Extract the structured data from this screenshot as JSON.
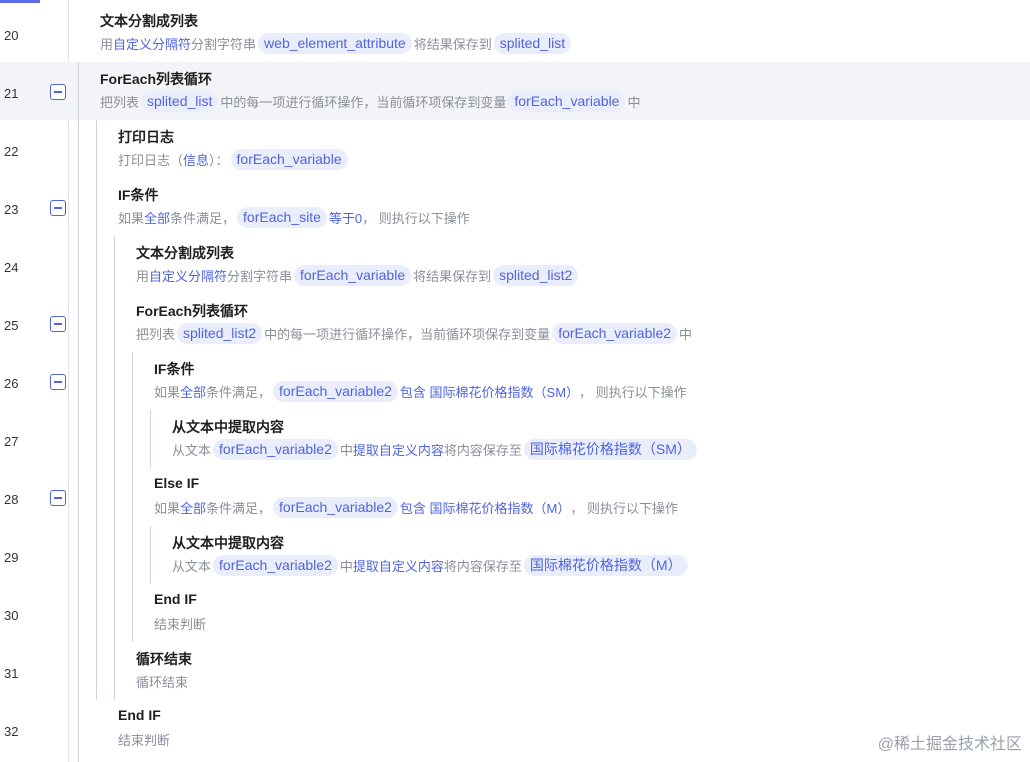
{
  "lines": [
    {
      "num": "20",
      "title": "文本分割成列表",
      "desc": [
        {
          "t": "text",
          "v": "用"
        },
        {
          "t": "kw",
          "v": "自定义分隔符"
        },
        {
          "t": "text",
          "v": "分割字符串"
        },
        {
          "t": "chip",
          "v": "web_element_attribute"
        },
        {
          "t": "text",
          "v": "将结果保存到"
        },
        {
          "t": "chip",
          "v": "splited_list"
        }
      ]
    },
    {
      "num": "21",
      "title": "ForEach列表循环",
      "desc": [
        {
          "t": "text",
          "v": "把列表"
        },
        {
          "t": "chip",
          "v": "splited_list"
        },
        {
          "t": "text",
          "v": "中的每一项进行循环操作，当前循环项保存到变量"
        },
        {
          "t": "chip",
          "v": "forEach_variable"
        },
        {
          "t": "text",
          "v": "中"
        }
      ]
    },
    {
      "num": "22",
      "title": "打印日志",
      "desc": [
        {
          "t": "text",
          "v": "打印日志（"
        },
        {
          "t": "kw",
          "v": "信息"
        },
        {
          "t": "text",
          "v": "）："
        },
        {
          "t": "chip",
          "v": "forEach_variable"
        }
      ]
    },
    {
      "num": "23",
      "title": "IF条件",
      "desc": [
        {
          "t": "text",
          "v": "如果"
        },
        {
          "t": "kw",
          "v": "全部"
        },
        {
          "t": "text",
          "v": "条件满足，"
        },
        {
          "t": "chip",
          "v": "forEach_site"
        },
        {
          "t": "kw",
          "v": "等于0"
        },
        {
          "t": "text",
          "v": "，  则执行以下操作"
        }
      ]
    },
    {
      "num": "24",
      "title": "文本分割成列表",
      "desc": [
        {
          "t": "text",
          "v": "用"
        },
        {
          "t": "kw",
          "v": "自定义分隔符"
        },
        {
          "t": "text",
          "v": "分割字符串"
        },
        {
          "t": "chip",
          "v": "forEach_variable"
        },
        {
          "t": "text",
          "v": "将结果保存到"
        },
        {
          "t": "chip",
          "v": "splited_list2"
        }
      ]
    },
    {
      "num": "25",
      "title": "ForEach列表循环",
      "desc": [
        {
          "t": "text",
          "v": "把列表"
        },
        {
          "t": "chip",
          "v": "splited_list2"
        },
        {
          "t": "text",
          "v": "中的每一项进行循环操作，当前循环项保存到变量"
        },
        {
          "t": "chip",
          "v": "forEach_variable2"
        },
        {
          "t": "text",
          "v": "中"
        }
      ]
    },
    {
      "num": "26",
      "title": "IF条件",
      "desc": [
        {
          "t": "text",
          "v": "如果"
        },
        {
          "t": "kw",
          "v": "全部"
        },
        {
          "t": "text",
          "v": "条件满足，"
        },
        {
          "t": "chip",
          "v": "forEach_variable2"
        },
        {
          "t": "kw",
          "v": "包含 国际棉花价格指数（SM）"
        },
        {
          "t": "text",
          "v": "，  则执行以下操作"
        }
      ]
    },
    {
      "num": "27",
      "title": "从文本中提取内容",
      "desc": [
        {
          "t": "text",
          "v": "从文本"
        },
        {
          "t": "chip",
          "v": "forEach_variable2"
        },
        {
          "t": "text",
          "v": "中"
        },
        {
          "t": "kw",
          "v": "提取自定义内容"
        },
        {
          "t": "text",
          "v": "将内容保存至"
        },
        {
          "t": "chip",
          "v": "国际棉花价格指数（SM）"
        }
      ]
    },
    {
      "num": "28",
      "title": "Else IF",
      "desc": [
        {
          "t": "text",
          "v": "如果"
        },
        {
          "t": "kw",
          "v": "全部"
        },
        {
          "t": "text",
          "v": "条件满足，"
        },
        {
          "t": "chip",
          "v": "forEach_variable2"
        },
        {
          "t": "kw",
          "v": "包含 国际棉花价格指数（M）"
        },
        {
          "t": "text",
          "v": "，  则执行以下操作"
        }
      ]
    },
    {
      "num": "29",
      "title": "从文本中提取内容",
      "desc": [
        {
          "t": "text",
          "v": "从文本"
        },
        {
          "t": "chip",
          "v": "forEach_variable2"
        },
        {
          "t": "text",
          "v": "中"
        },
        {
          "t": "kw",
          "v": "提取自定义内容"
        },
        {
          "t": "text",
          "v": "将内容保存至"
        },
        {
          "t": "chip",
          "v": "国际棉花价格指数（M）"
        }
      ]
    },
    {
      "num": "30",
      "title": "End IF",
      "desc": [
        {
          "t": "text",
          "v": "结束判断"
        }
      ]
    },
    {
      "num": "31",
      "title": "循环结束",
      "desc": [
        {
          "t": "text",
          "v": "循环结束"
        }
      ]
    },
    {
      "num": "32",
      "title": "End IF",
      "desc": [
        {
          "t": "text",
          "v": "结束判断"
        }
      ]
    }
  ],
  "watermark": "@稀土掘金技术社区"
}
